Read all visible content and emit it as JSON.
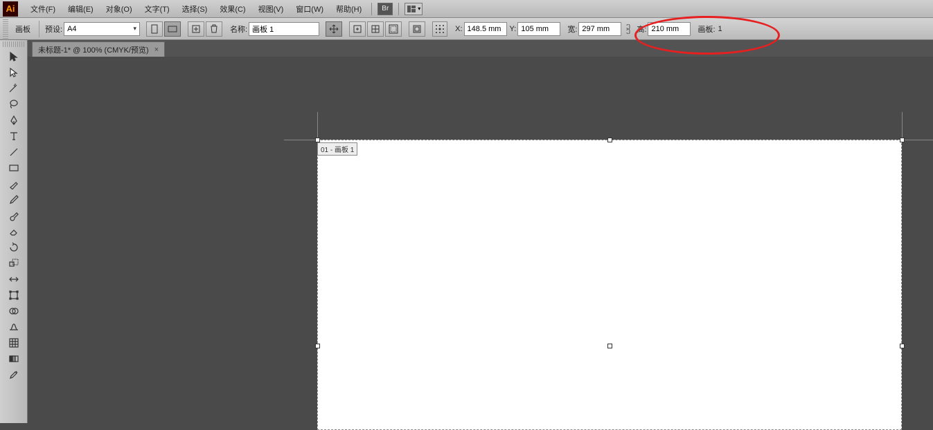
{
  "app": {
    "logo": "Ai"
  },
  "menu": {
    "items": [
      "文件(F)",
      "编辑(E)",
      "对象(O)",
      "文字(T)",
      "选择(S)",
      "效果(C)",
      "视图(V)",
      "窗口(W)",
      "帮助(H)"
    ],
    "bridge": "Br"
  },
  "control": {
    "tool_name": "画板",
    "preset_label": "预设:",
    "preset_value": "A4",
    "name_label": "名称:",
    "name_value": "画板 1",
    "x_label": "X:",
    "x_value": "148.5 mm",
    "y_label": "Y:",
    "y_value": "105 mm",
    "w_label": "宽:",
    "w_value": "297 mm",
    "h_label": "高:",
    "h_value": "210 mm",
    "artboards_label": "画板:",
    "artboards_count": "1"
  },
  "tab": {
    "title": "未标题-1* @ 100% (CMYK/预览)",
    "close": "×"
  },
  "artboard": {
    "label": "01 - 画板 1"
  }
}
